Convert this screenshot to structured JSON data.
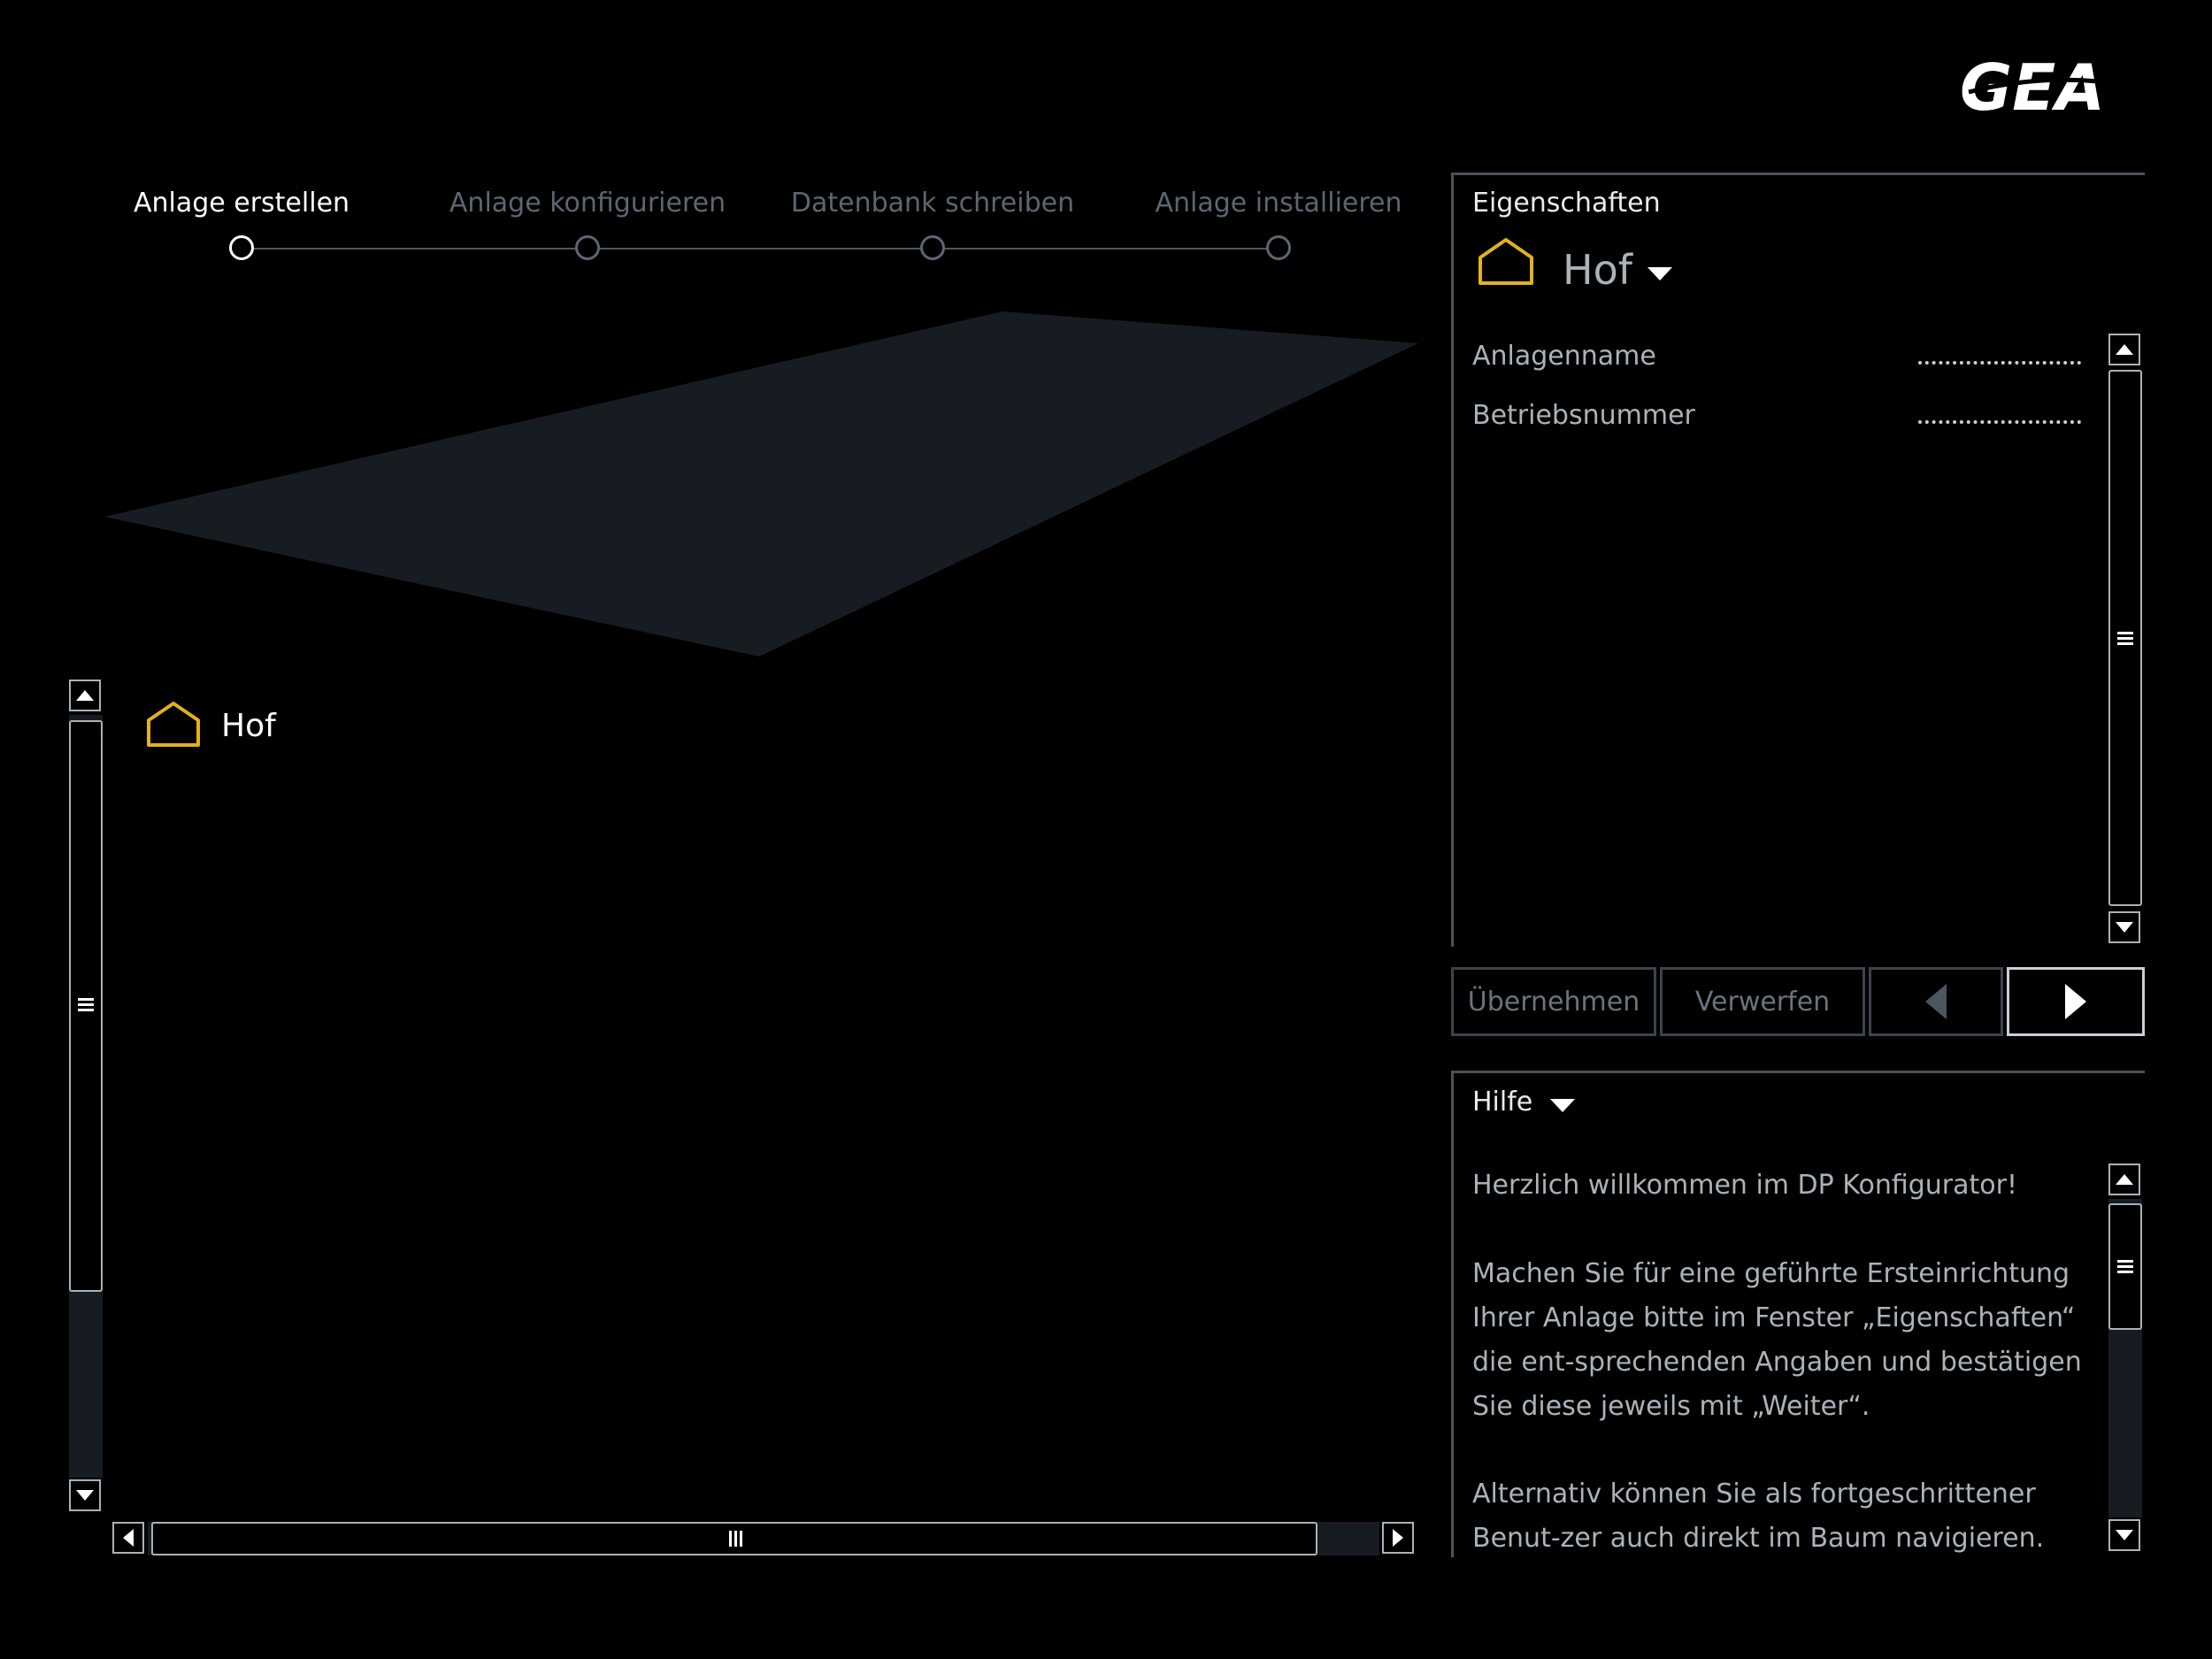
{
  "brand": {
    "logo_text": "GEA"
  },
  "steps": [
    {
      "label": "Anlage erstellen",
      "state": "active"
    },
    {
      "label": "Anlage konfigurieren",
      "state": "inactive"
    },
    {
      "label": "Datenbank schreiben",
      "state": "inactive"
    },
    {
      "label": "Anlage installieren",
      "state": "inactive"
    }
  ],
  "tree": {
    "root_label": "Hof"
  },
  "properties": {
    "title": "Eigenschaften",
    "object": "Hof",
    "fields": [
      {
        "label": "Anlagenname",
        "value": ""
      },
      {
        "label": "Betriebsnummer",
        "value": ""
      }
    ]
  },
  "actions": {
    "apply_label": "Übernehmen",
    "discard_label": "Verwerfen"
  },
  "help": {
    "title": "Hilfe",
    "paragraphs": [
      "Herzlich willkommen im DP Konfigurator!",
      "Machen Sie für eine geführte Ersteinrichtung Ihrer Anlage bitte im Fenster „Eigenschaften“ die ent-sprechenden Angaben und bestätigen Sie diese jeweils mit „Weiter“.",
      "Alternativ können Sie als fortgeschrittener Benut-zer auch direkt im Baum navigieren."
    ]
  },
  "colors": {
    "background": "#000000",
    "accent_icon": "#e2b21c",
    "floor": "#161c22",
    "border": "#4a525a"
  },
  "icons": [
    "home-icon",
    "chevron-down-icon",
    "arrow-up-icon",
    "arrow-down-icon",
    "arrow-left-icon",
    "arrow-right-icon",
    "grip-icon"
  ]
}
